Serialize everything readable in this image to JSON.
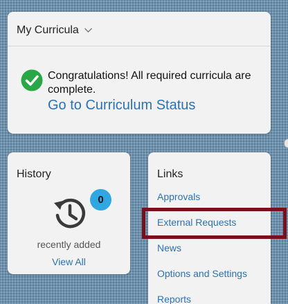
{
  "curricula": {
    "title": "My Curricula",
    "message": "Congratulations! All required curricula are complete.",
    "status_link": "Go to Curriculum Status"
  },
  "history": {
    "title": "History",
    "badge_count": "0",
    "recent_label": "recently added",
    "view_all": "View All"
  },
  "links": {
    "title": "Links",
    "items": [
      {
        "label": "Approvals"
      },
      {
        "label": "External Requests"
      },
      {
        "label": "News"
      },
      {
        "label": "Options and Settings"
      },
      {
        "label": "Reports"
      }
    ]
  },
  "colors": {
    "link": "#2a72b8",
    "success": "#27a844",
    "badge": "#2fa7e2",
    "highlight": "#7a0f1c"
  }
}
